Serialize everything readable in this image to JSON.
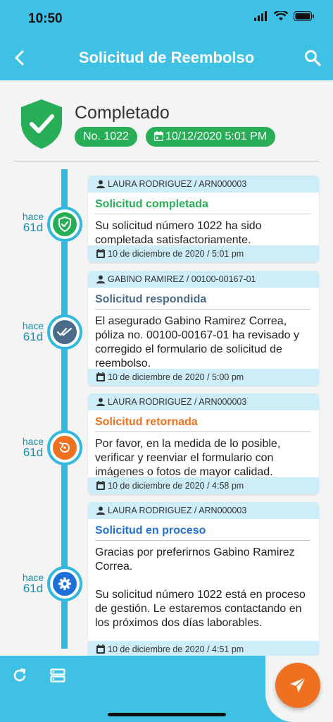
{
  "status_bar": {
    "time": "10:50"
  },
  "app_bar": {
    "title": "Solicitud de Reembolso"
  },
  "header": {
    "status": "Completado",
    "request_number": "No. 1022",
    "datetime": "10/12/2020 5:01 PM",
    "status_color": "#27ae57"
  },
  "timeline": [
    {
      "ago_label": "hace",
      "ago_value": "61d",
      "user": "LAURA RODRIGUEZ / ARN000003",
      "title": "Solicitud completada",
      "title_color": "#27ae57",
      "message": "Su solicitud número 1022 ha sido completada satisfactoriamente.",
      "date": "10 de diciembre de 2020 / 5:01 pm",
      "icon": "shield-check-icon",
      "icon_color": "#27ae57"
    },
    {
      "ago_label": "hace",
      "ago_value": "61d",
      "user": "GABINO RAMIREZ / 00100-00167-01",
      "title": "Solicitud respondida",
      "title_color": "#4a6b8a",
      "message": "El asegurado Gabino Ramirez Correa, póliza no. 00100-00167-01 ha revisado y corregido el formulario de solicitud de reembolso.",
      "date": "10 de diciembre de 2020 / 5:00 pm",
      "icon": "double-check-icon",
      "icon_color": "#4a6b8a"
    },
    {
      "ago_label": "hace",
      "ago_value": "61d",
      "user": "LAURA RODRIGUEZ / ARN000003",
      "title": "Solicitud retornada",
      "title_color": "#f0701f",
      "message": "Por favor, en la medida de lo posible, verificar y reenviar el formulario con imágenes o fotos de mayor calidad.",
      "date": "10 de diciembre de 2020 / 4:58 pm",
      "icon": "return-icon",
      "icon_color": "#f0701f"
    },
    {
      "ago_label": "hace",
      "ago_value": "61d",
      "user": "LAURA RODRIGUEZ / ARN000003",
      "title": "Solicitud en proceso",
      "title_color": "#1e6fd9",
      "message": "Gracias por preferirnos Gabino Ramirez Correa.\n\nSu solicitud número 1022 está en proceso de gestión. Le estaremos contactando en los próximos dos días laborables.",
      "date": "10 de diciembre de 2020 / 4:51 pm",
      "icon": "gear-icon",
      "icon_color": "#1e6fd9"
    }
  ],
  "colors": {
    "accent": "#3fc1e6",
    "card_band": "#cdeef8",
    "fab": "#f0701f"
  }
}
